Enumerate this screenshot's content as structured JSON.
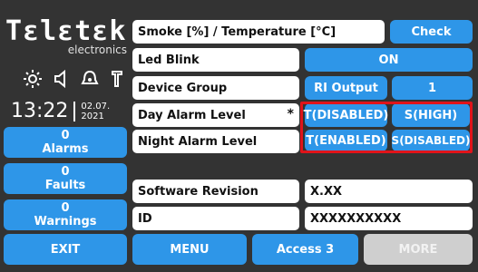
{
  "logo": {
    "main": "Tεlεtεk",
    "sub": "electronics"
  },
  "status_icons": [
    "sun-icon",
    "speaker-icon",
    "alarm-bell-icon",
    "phone-icon"
  ],
  "clock": {
    "time": "13:22",
    "date_line1": "02.07.",
    "date_line2": "2021"
  },
  "left_buttons": {
    "alarms": {
      "count": "0",
      "label": "Alarms"
    },
    "faults": {
      "count": "0",
      "label": "Faults"
    },
    "warnings": {
      "count": "0",
      "label": "Warnings"
    },
    "exit": "EXIT"
  },
  "rows": {
    "smoke_temp": {
      "label": "Smoke [%] / Temperature [°C]",
      "button": "Check"
    },
    "led_blink": {
      "label": "Led Blink",
      "value": "ON"
    },
    "device_group": {
      "label": "Device Group",
      "output": "RI Output",
      "value": "1"
    },
    "day_alarm": {
      "label": "Day Alarm Level",
      "marker": "*",
      "t": "T(DISABLED)",
      "s": "S(HIGH)"
    },
    "night_alarm": {
      "label": "Night Alarm Level",
      "t": "T(ENABLED)",
      "s": "S(DISABLED)"
    },
    "software": {
      "label": "Software Revision",
      "value": "X.XX"
    },
    "id": {
      "label": "ID",
      "value": "XXXXXXXXXX"
    }
  },
  "bottom": {
    "menu": "MENU",
    "access": "Access 3",
    "more": "MORE"
  },
  "colors": {
    "blue": "#2e96e8",
    "highlight": "#e0141a",
    "background": "#333333"
  }
}
